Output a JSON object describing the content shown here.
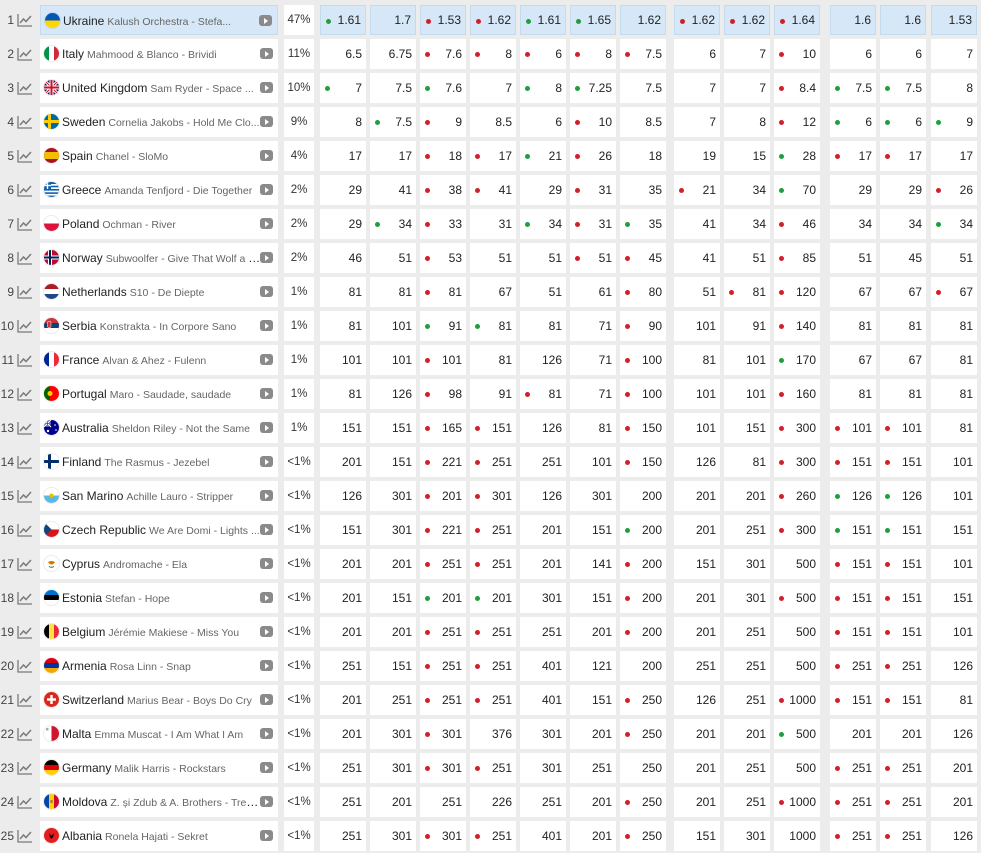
{
  "rows": [
    {
      "rank": "1",
      "country": "Ukraine",
      "song": "Kalush Orchestra - Stefa...",
      "flag": "ua",
      "chance": "47%",
      "odds": [
        "1.61",
        "1.7",
        "1.53",
        "1.62",
        "1.61",
        "1.65",
        "1.62",
        "1.62",
        "1.62",
        "1.64",
        "1.6",
        "1.6",
        "1.53"
      ],
      "trend": [
        "up",
        "",
        "down",
        "down",
        "up",
        "up",
        "",
        "down",
        "down",
        "down",
        "",
        "",
        ""
      ]
    },
    {
      "rank": "2",
      "country": "Italy",
      "song": "Mahmood & Blanco - Brividi",
      "flag": "it",
      "chance": "11%",
      "odds": [
        "6.5",
        "6.75",
        "7.6",
        "8",
        "6",
        "8",
        "7.5",
        "6",
        "7",
        "10",
        "6",
        "6",
        "7"
      ],
      "trend": [
        "",
        "",
        "down",
        "down",
        "down",
        "down",
        "down",
        "",
        "",
        "down",
        "",
        "",
        ""
      ]
    },
    {
      "rank": "3",
      "country": "United Kingdom",
      "song": "Sam Ryder - Space ...",
      "flag": "gb",
      "chance": "10%",
      "odds": [
        "7",
        "7.5",
        "7.6",
        "7",
        "8",
        "7.25",
        "7.5",
        "7",
        "7",
        "8.4",
        "7.5",
        "7.5",
        "8"
      ],
      "trend": [
        "up",
        "",
        "up",
        "",
        "up",
        "up",
        "",
        "",
        "",
        "down",
        "up",
        "up",
        ""
      ]
    },
    {
      "rank": "4",
      "country": "Sweden",
      "song": "Cornelia Jakobs - Hold Me Clo...",
      "flag": "se",
      "chance": "9%",
      "odds": [
        "8",
        "7.5",
        "9",
        "8.5",
        "6",
        "10",
        "8.5",
        "7",
        "8",
        "12",
        "6",
        "6",
        "9"
      ],
      "trend": [
        "",
        "up",
        "down",
        "",
        "",
        "down",
        "",
        "",
        "",
        "down",
        "up",
        "up",
        "up"
      ]
    },
    {
      "rank": "5",
      "country": "Spain",
      "song": "Chanel - SloMo",
      "flag": "es",
      "chance": "4%",
      "odds": [
        "17",
        "17",
        "18",
        "17",
        "21",
        "26",
        "18",
        "19",
        "15",
        "28",
        "17",
        "17",
        "17"
      ],
      "trend": [
        "",
        "",
        "down",
        "down",
        "up",
        "down",
        "",
        "",
        "",
        "up",
        "down",
        "down",
        ""
      ]
    },
    {
      "rank": "6",
      "country": "Greece",
      "song": "Amanda Tenfjord - Die Together",
      "flag": "gr",
      "chance": "2%",
      "odds": [
        "29",
        "41",
        "38",
        "41",
        "29",
        "31",
        "35",
        "21",
        "34",
        "70",
        "29",
        "29",
        "26"
      ],
      "trend": [
        "",
        "",
        "down",
        "down",
        "",
        "down",
        "",
        "down",
        "",
        "up",
        "",
        "",
        "down"
      ]
    },
    {
      "rank": "7",
      "country": "Poland",
      "song": "Ochman - River",
      "flag": "pl",
      "chance": "2%",
      "odds": [
        "29",
        "34",
        "33",
        "31",
        "34",
        "31",
        "35",
        "41",
        "34",
        "46",
        "34",
        "34",
        "34"
      ],
      "trend": [
        "",
        "up",
        "down",
        "",
        "up",
        "down",
        "up",
        "",
        "",
        "down",
        "",
        "",
        "up"
      ]
    },
    {
      "rank": "8",
      "country": "Norway",
      "song": "Subwoolfer - Give That Wolf a B...",
      "flag": "no",
      "chance": "2%",
      "odds": [
        "46",
        "51",
        "53",
        "51",
        "51",
        "51",
        "45",
        "41",
        "51",
        "85",
        "51",
        "45",
        "51"
      ],
      "trend": [
        "",
        "",
        "down",
        "",
        "",
        "down",
        "down",
        "",
        "",
        "down",
        "",
        "",
        ""
      ]
    },
    {
      "rank": "9",
      "country": "Netherlands",
      "song": "S10 - De Diepte",
      "flag": "nl",
      "chance": "1%",
      "odds": [
        "81",
        "81",
        "81",
        "67",
        "51",
        "61",
        "80",
        "51",
        "81",
        "120",
        "67",
        "67",
        "67"
      ],
      "trend": [
        "",
        "",
        "down",
        "",
        "",
        "",
        "down",
        "",
        "down",
        "down",
        "",
        "",
        "down"
      ]
    },
    {
      "rank": "10",
      "country": "Serbia",
      "song": "Konstrakta - In Corpore Sano",
      "flag": "rs",
      "chance": "1%",
      "odds": [
        "81",
        "101",
        "91",
        "81",
        "81",
        "71",
        "90",
        "101",
        "91",
        "140",
        "81",
        "81",
        "81"
      ],
      "trend": [
        "",
        "",
        "up",
        "up",
        "",
        "",
        "down",
        "",
        "",
        "down",
        "",
        "",
        ""
      ]
    },
    {
      "rank": "11",
      "country": "France",
      "song": "Alvan & Ahez - Fulenn",
      "flag": "fr",
      "chance": "1%",
      "odds": [
        "101",
        "101",
        "101",
        "81",
        "126",
        "71",
        "100",
        "81",
        "101",
        "170",
        "67",
        "67",
        "81"
      ],
      "trend": [
        "",
        "",
        "down",
        "",
        "",
        "",
        "down",
        "",
        "",
        "up",
        "",
        "",
        ""
      ]
    },
    {
      "rank": "12",
      "country": "Portugal",
      "song": "Maro - Saudade, saudade",
      "flag": "pt",
      "chance": "1%",
      "odds": [
        "81",
        "126",
        "98",
        "91",
        "81",
        "71",
        "100",
        "101",
        "101",
        "160",
        "81",
        "81",
        "81"
      ],
      "trend": [
        "",
        "",
        "down",
        "",
        "down",
        "",
        "down",
        "",
        "",
        "down",
        "",
        "",
        ""
      ]
    },
    {
      "rank": "13",
      "country": "Australia",
      "song": "Sheldon Riley - Not the Same",
      "flag": "au",
      "chance": "1%",
      "odds": [
        "151",
        "151",
        "165",
        "151",
        "126",
        "81",
        "150",
        "101",
        "151",
        "300",
        "101",
        "101",
        "81"
      ],
      "trend": [
        "",
        "",
        "down",
        "down",
        "",
        "",
        "down",
        "",
        "",
        "down",
        "down",
        "down",
        ""
      ]
    },
    {
      "rank": "14",
      "country": "Finland",
      "song": "The Rasmus - Jezebel",
      "flag": "fi",
      "chance": "<1%",
      "odds": [
        "201",
        "151",
        "221",
        "251",
        "251",
        "101",
        "150",
        "126",
        "81",
        "300",
        "151",
        "151",
        "101"
      ],
      "trend": [
        "",
        "",
        "down",
        "down",
        "",
        "",
        "down",
        "",
        "",
        "down",
        "down",
        "down",
        ""
      ]
    },
    {
      "rank": "15",
      "country": "San Marino",
      "song": "Achille Lauro - Stripper",
      "flag": "sm",
      "chance": "<1%",
      "odds": [
        "126",
        "301",
        "201",
        "301",
        "126",
        "301",
        "200",
        "201",
        "201",
        "260",
        "126",
        "126",
        "101"
      ],
      "trend": [
        "",
        "",
        "down",
        "down",
        "",
        "",
        "",
        "",
        "",
        "down",
        "up",
        "up",
        ""
      ]
    },
    {
      "rank": "16",
      "country": "Czech Republic",
      "song": "We Are Domi - Lights ...",
      "flag": "cz",
      "chance": "<1%",
      "odds": [
        "151",
        "301",
        "221",
        "251",
        "201",
        "151",
        "200",
        "201",
        "251",
        "300",
        "151",
        "151",
        "151"
      ],
      "trend": [
        "",
        "",
        "down",
        "down",
        "",
        "",
        "up",
        "",
        "",
        "down",
        "up",
        "up",
        ""
      ]
    },
    {
      "rank": "17",
      "country": "Cyprus",
      "song": "Andromache - Ela",
      "flag": "cy",
      "chance": "<1%",
      "odds": [
        "201",
        "201",
        "251",
        "251",
        "201",
        "141",
        "200",
        "151",
        "301",
        "500",
        "151",
        "151",
        "101"
      ],
      "trend": [
        "",
        "",
        "down",
        "down",
        "",
        "",
        "down",
        "",
        "",
        "",
        "down",
        "down",
        ""
      ]
    },
    {
      "rank": "18",
      "country": "Estonia",
      "song": "Stefan - Hope",
      "flag": "ee",
      "chance": "<1%",
      "odds": [
        "201",
        "151",
        "201",
        "201",
        "301",
        "151",
        "200",
        "201",
        "301",
        "500",
        "151",
        "151",
        "151"
      ],
      "trend": [
        "",
        "",
        "up",
        "up",
        "",
        "",
        "down",
        "",
        "",
        "down",
        "down",
        "down",
        ""
      ]
    },
    {
      "rank": "19",
      "country": "Belgium",
      "song": "Jérémie Makiese - Miss You",
      "flag": "be",
      "chance": "<1%",
      "odds": [
        "201",
        "201",
        "251",
        "251",
        "251",
        "201",
        "200",
        "201",
        "251",
        "500",
        "151",
        "151",
        "101"
      ],
      "trend": [
        "",
        "",
        "down",
        "down",
        "",
        "",
        "down",
        "",
        "",
        "",
        "down",
        "down",
        ""
      ]
    },
    {
      "rank": "20",
      "country": "Armenia",
      "song": "Rosa Linn - Snap",
      "flag": "am",
      "chance": "<1%",
      "odds": [
        "251",
        "151",
        "251",
        "251",
        "401",
        "121",
        "200",
        "251",
        "251",
        "500",
        "251",
        "251",
        "126"
      ],
      "trend": [
        "",
        "",
        "down",
        "down",
        "",
        "",
        "",
        "",
        "",
        "",
        "down",
        "down",
        ""
      ]
    },
    {
      "rank": "21",
      "country": "Switzerland",
      "song": "Marius Bear - Boys Do Cry",
      "flag": "ch",
      "chance": "<1%",
      "odds": [
        "201",
        "251",
        "251",
        "251",
        "401",
        "151",
        "250",
        "126",
        "251",
        "1000",
        "151",
        "151",
        "81"
      ],
      "trend": [
        "",
        "",
        "down",
        "down",
        "",
        "",
        "down",
        "",
        "",
        "down",
        "down",
        "down",
        ""
      ]
    },
    {
      "rank": "22",
      "country": "Malta",
      "song": "Emma Muscat - I Am What I Am",
      "flag": "mt",
      "chance": "<1%",
      "odds": [
        "201",
        "301",
        "301",
        "376",
        "301",
        "201",
        "250",
        "201",
        "201",
        "500",
        "201",
        "201",
        "126"
      ],
      "trend": [
        "",
        "",
        "down",
        "",
        "",
        "",
        "down",
        "",
        "",
        "up",
        "",
        "",
        ""
      ]
    },
    {
      "rank": "23",
      "country": "Germany",
      "song": "Malik Harris - Rockstars",
      "flag": "de",
      "chance": "<1%",
      "odds": [
        "251",
        "301",
        "301",
        "251",
        "301",
        "251",
        "250",
        "201",
        "251",
        "500",
        "251",
        "251",
        "201"
      ],
      "trend": [
        "",
        "",
        "down",
        "down",
        "",
        "",
        "",
        "",
        "",
        "",
        "down",
        "down",
        ""
      ]
    },
    {
      "rank": "24",
      "country": "Moldova",
      "song": "Z. și Zdub & A. Brothers - Trenu...",
      "flag": "md",
      "chance": "<1%",
      "odds": [
        "251",
        "201",
        "251",
        "226",
        "251",
        "201",
        "250",
        "201",
        "251",
        "1000",
        "251",
        "251",
        "201"
      ],
      "trend": [
        "",
        "",
        "",
        "",
        "",
        "",
        "down",
        "",
        "",
        "down",
        "down",
        "down",
        ""
      ]
    },
    {
      "rank": "25",
      "country": "Albania",
      "song": "Ronela Hajati - Sekret",
      "flag": "al",
      "chance": "<1%",
      "odds": [
        "251",
        "301",
        "301",
        "251",
        "401",
        "201",
        "250",
        "151",
        "301",
        "1000",
        "251",
        "251",
        "126"
      ],
      "trend": [
        "",
        "",
        "down",
        "down",
        "",
        "",
        "down",
        "",
        "",
        "",
        "down",
        "down",
        ""
      ]
    }
  ],
  "colors": {
    "up": "#1e9e3e",
    "down": "#d0202a",
    "highlight": "#d6e8f7"
  }
}
